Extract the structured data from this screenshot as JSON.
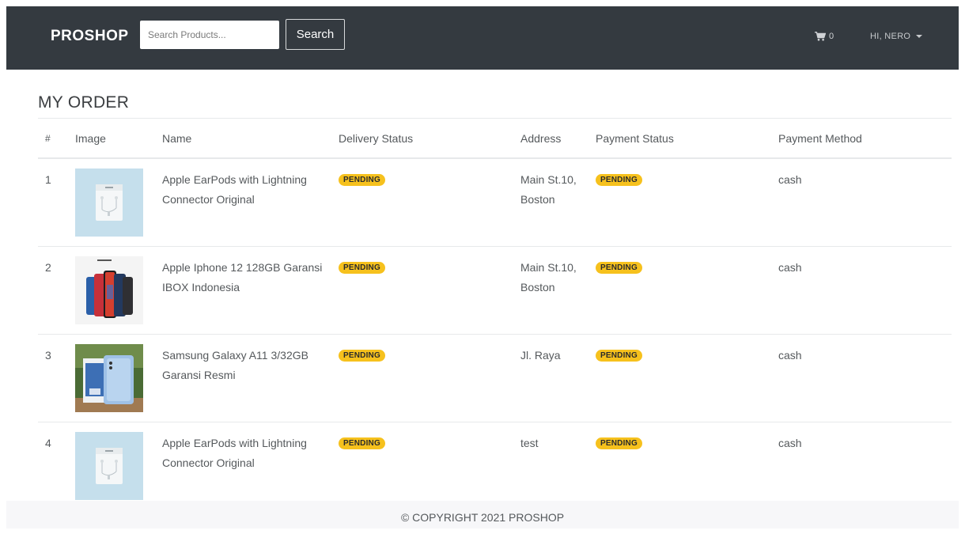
{
  "navbar": {
    "brand": "PROSHOP",
    "search_placeholder": "Search Products...",
    "search_button": "Search",
    "cart_count": "0",
    "user_label": "HI, NERO",
    "icons": {
      "cart": "shopping-cart-icon",
      "caret": "caret-down-icon"
    }
  },
  "page": {
    "title": "MY ORDER"
  },
  "table": {
    "headers": {
      "num": "#",
      "image": "Image",
      "name": "Name",
      "delivery": "Delivery Status",
      "address": "Address",
      "payment": "Payment Status",
      "method": "Payment Method"
    },
    "rows": [
      {
        "num": "1",
        "image": "earpods-product-image",
        "name": "Apple EarPods with Lightning Connector Original",
        "delivery": "PENDING",
        "address": "Main St.10, Boston",
        "payment": "PENDING",
        "method": "cash"
      },
      {
        "num": "2",
        "image": "iphone-12-product-image",
        "name": "Apple Iphone 12 128GB Garansi IBOX Indonesia",
        "delivery": "PENDING",
        "address": "Main St.10, Boston",
        "payment": "PENDING",
        "method": "cash"
      },
      {
        "num": "3",
        "image": "galaxy-a11-product-image",
        "name": "Samsung Galaxy A11 3/32GB Garansi Resmi",
        "delivery": "PENDING",
        "address": "Jl. Raya",
        "payment": "PENDING",
        "method": "cash"
      },
      {
        "num": "4",
        "image": "earpods-product-image",
        "name": "Apple EarPods with Lightning Connector Original",
        "delivery": "PENDING",
        "address": "test",
        "payment": "PENDING",
        "method": "cash"
      }
    ]
  },
  "footer": {
    "text": "© COPYRIGHT 2021 PROSHOP"
  },
  "colors": {
    "navbar_bg": "#343a40",
    "badge_warning": "#f6c11d",
    "footer_bg": "#f7f7f9",
    "earpods_bg": "#c5dfec"
  }
}
